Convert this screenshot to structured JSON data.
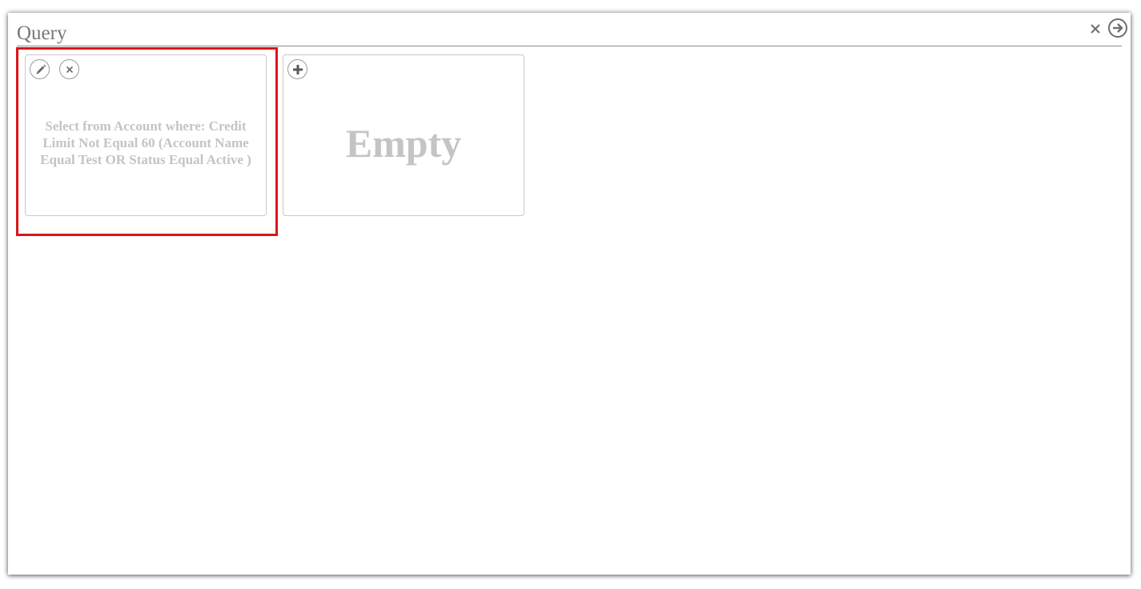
{
  "panel": {
    "title": "Query",
    "close_icon": "close-icon",
    "go_icon": "arrow-right-circle-icon"
  },
  "cards": [
    {
      "type": "query",
      "text": "Select from Account where: Credit Limit Not Equal 60 (Account Name Equal Test OR Status Equal Active )",
      "actions": [
        "pencil-icon",
        "close-icon"
      ],
      "selected": true
    },
    {
      "type": "empty",
      "text": "Empty",
      "actions": [
        "plus-icon"
      ],
      "selected": false
    }
  ],
  "colors": {
    "selection_outline": "#d9161c",
    "muted_text": "#c4c4c4",
    "title_text": "#777777"
  }
}
